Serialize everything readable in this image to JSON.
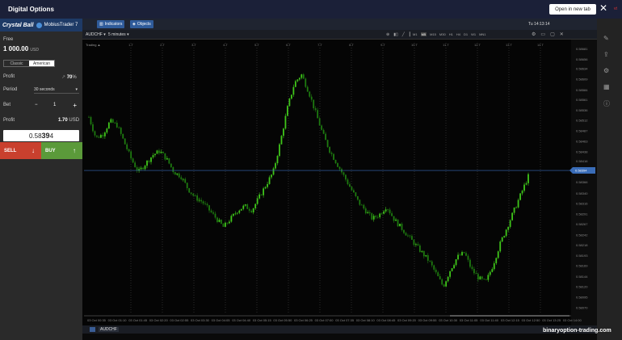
{
  "window": {
    "title": "Digital Options",
    "open_in_new_tab": "Open in new tab",
    "close": "✕",
    "corner_mark": "vt"
  },
  "brand": {
    "name": "Crystal Ball",
    "sub": "MobiusTrader 7"
  },
  "panel": {
    "balance_label": "Free",
    "balance": "1 000.00",
    "currency": "USD",
    "option_types": [
      "Classic",
      "American"
    ],
    "active_option": "American",
    "profit_label": "Profit",
    "profit_pct": "70",
    "profit_pct_unit": "%",
    "period_label": "Period",
    "period_value": "30 seconds",
    "bet_label": "Bet",
    "bet_value": "1",
    "minus": "−",
    "plus": "+",
    "profit2_label": "Profit",
    "profit2_value": "1.70",
    "quote_prefix": "0.58",
    "quote_big": "39",
    "quote_suffix": "4",
    "sell_label": "SELL",
    "buy_label": "BUY"
  },
  "toolbar": {
    "indicators": "Indicators",
    "objects": "Objects",
    "clock": "Tu 14:13:14",
    "symbol": "AUDCHF ▾",
    "timeframe": "5 minutes ▾",
    "periods": [
      "M1",
      "M5",
      "M15",
      "M30",
      "H1",
      "H4",
      "D1",
      "W1",
      "MN1"
    ],
    "active_period": "M5",
    "bottom_symbol": "AUDCHF",
    "trading_label": "Trading ▲"
  },
  "chart_data": {
    "type": "candlestick",
    "symbol": "AUDCHF",
    "timeframe": "M5",
    "current_price": 0.58394,
    "ylim": [
      0.58055,
      0.58695
    ],
    "y_ticks": [
      0.58681,
      0.58656,
      0.58634,
      0.58609,
      0.58584,
      0.58561,
      0.58536,
      0.58512,
      0.58487,
      0.58463,
      0.58438,
      0.58416,
      0.58394,
      0.58366,
      0.5834,
      0.58316,
      0.58291,
      0.58267,
      0.58242,
      0.58218,
      0.58193,
      0.58169,
      0.58144,
      0.5812,
      0.58095,
      0.5807
    ],
    "x_labels": [
      "03 Oct 00:35",
      "03 Oct 01:10",
      "03 Oct 01:45",
      "03 Oct 02:20",
      "03 Oct 02:55",
      "03 Oct 03:30",
      "03 Oct 04:05",
      "03 Oct 04:40",
      "03 Oct 05:15",
      "03 Oct 05:50",
      "03 Oct 06:25",
      "03 Oct 07:00",
      "03 Oct 07:35",
      "03 Oct 08:10",
      "03 Oct 08:45",
      "03 Oct 09:20",
      "03 Oct 09:55",
      "03 Oct 10:30",
      "03 Oct 11:05",
      "03 Oct 11:40",
      "03 Oct 12:15",
      "03 Oct 12:50",
      "03 Oct 13:25",
      "03 Oct 14:00"
    ],
    "day_labels": [
      "1 T",
      "2 T",
      "3 T",
      "4 T",
      "5 T",
      "6 T",
      "7 T",
      "8 T",
      "9 T",
      "10 T",
      "11 T",
      "12 T",
      "13 T",
      "14 T"
    ],
    "close_path": [
      0.5852,
      0.5847,
      0.5848,
      0.5851,
      0.585,
      0.5846,
      0.5842,
      0.5839,
      0.5841,
      0.5843,
      0.5844,
      0.5842,
      0.5839,
      0.5838,
      0.5835,
      0.5833,
      0.5832,
      0.583,
      0.5828,
      0.5826,
      0.5828,
      0.583,
      0.5831,
      0.583,
      0.5833,
      0.5836,
      0.5839,
      0.5846,
      0.5854,
      0.586,
      0.5862,
      0.5858,
      0.5853,
      0.5848,
      0.5844,
      0.5841,
      0.5838,
      0.5835,
      0.5832,
      0.583,
      0.5828,
      0.5829,
      0.5831,
      0.5828,
      0.5826,
      0.5824,
      0.5822,
      0.582,
      0.5818,
      0.5815,
      0.5812,
      0.5816,
      0.5819,
      0.582,
      0.5816,
      0.5814,
      0.5813,
      0.5817,
      0.5822,
      0.5826,
      0.583,
      0.5834,
      0.5838
    ],
    "grid": true
  },
  "colors": {
    "bull": "#3fc51a",
    "bear": "#1e7a10",
    "price_line": "#3a6db8",
    "sell": "#c9402e",
    "buy": "#5b9a3a"
  },
  "watermark": "binaryoption-trading.com"
}
